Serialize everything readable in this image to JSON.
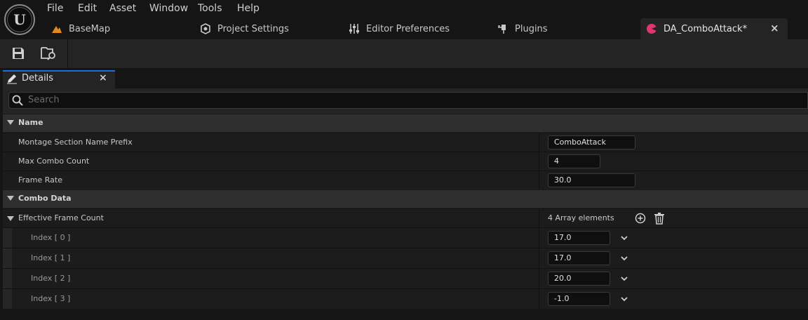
{
  "menu": [
    "File",
    "Edit",
    "Asset",
    "Window",
    "Tools",
    "Help"
  ],
  "tabs": [
    {
      "label": "BaseMap",
      "icon": "level-icon"
    },
    {
      "label": "Project Settings",
      "icon": "gear-cube-icon"
    },
    {
      "label": "Editor Preferences",
      "icon": "sliders-icon"
    },
    {
      "label": "Plugins",
      "icon": "plug-icon"
    },
    {
      "label": "DA_ComboAttack*",
      "icon": "data-asset-icon",
      "active": true
    }
  ],
  "panel": {
    "title": "Details",
    "close": "×"
  },
  "search": {
    "placeholder": "Search"
  },
  "categories": {
    "name": "Name",
    "combo": "Combo Data"
  },
  "props": {
    "montage_prefix": {
      "label": "Montage Section Name Prefix",
      "value": "ComboAttack"
    },
    "max_combo": {
      "label": "Max Combo Count",
      "value": "4"
    },
    "frame_rate": {
      "label": "Frame Rate",
      "value": "30.0"
    },
    "effective": {
      "label": "Effective Frame Count",
      "summary": "4 Array elements"
    }
  },
  "array": [
    {
      "label": "Index [ 0 ]",
      "value": "17.0"
    },
    {
      "label": "Index [ 1 ]",
      "value": "17.0"
    },
    {
      "label": "Index [ 2 ]",
      "value": "20.0"
    },
    {
      "label": "Index [ 3 ]",
      "value": "-1.0"
    }
  ],
  "colors": {
    "accent": "#1d6fe0",
    "asset_icon": "#e0356f",
    "level_icon": "#e08a1e"
  }
}
